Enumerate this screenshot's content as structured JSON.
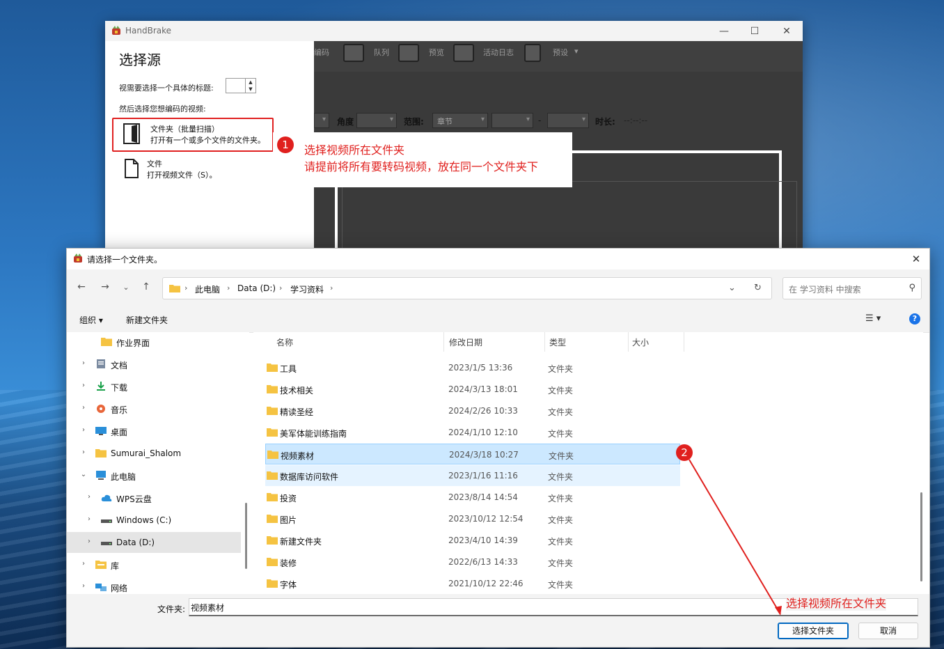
{
  "handbrake": {
    "title": "HandBrake",
    "toolbar": [
      "编码",
      "队列",
      "预览",
      "活动日志",
      "预设"
    ],
    "row2": {
      "angle_label": "角度",
      "range_label": "范围:",
      "range_value": "章节",
      "dash": "-",
      "duration_label": "时长:",
      "duration_value": "--:--:--"
    },
    "window_controls": {
      "minimize": "—",
      "maximize": "☐",
      "close": "✕"
    }
  },
  "source_panel": {
    "title": "选择源",
    "question1": "视需要选择一个具体的标题:",
    "question2": "然后选择您想编码的视频:",
    "folder_option": {
      "line1": "文件夹（批量扫描）",
      "line2": "打开有一个或多个文件的文件夹。"
    },
    "file_option": {
      "line1": "文件",
      "line2": "打开视频文件（S）。"
    }
  },
  "annotations": {
    "badge1": "1",
    "text1_line1": "选择视频所在文件夹",
    "text1_line2": "请提前将所有要转码视频，放在同一个文件夹下",
    "badge2": "2",
    "text2": "选择视频所在文件夹"
  },
  "dialog": {
    "title": "请选择一个文件夹。",
    "close": "✕",
    "breadcrumb": [
      "此电脑",
      "Data (D:)",
      "学习资料"
    ],
    "search_placeholder": "在 学习资料 中搜索",
    "commands": {
      "organize": "组织 ▾",
      "new_folder": "新建文件夹"
    },
    "help": "?",
    "nav_items": [
      {
        "label": "作业界面",
        "chevron": "",
        "indent": 1,
        "icon": "folder-icon",
        "color": "#f5c342"
      },
      {
        "label": "文档",
        "chevron": "›",
        "indent": 0,
        "icon": "document-icon",
        "color": "#7a8aa0"
      },
      {
        "label": "下载",
        "chevron": "›",
        "indent": 0,
        "icon": "download-icon",
        "color": "#1aa14a"
      },
      {
        "label": "音乐",
        "chevron": "›",
        "indent": 0,
        "icon": "music-icon",
        "color": "#e8663a"
      },
      {
        "label": "桌面",
        "chevron": "›",
        "indent": 0,
        "icon": "desktop-icon",
        "color": "#2a8fd9"
      },
      {
        "label": "Sumurai_Shalom",
        "chevron": "›",
        "indent": 0,
        "icon": "folder-icon",
        "color": "#f5c342"
      },
      {
        "label": "此电脑",
        "chevron": "⌄",
        "indent": 0,
        "icon": "computer-icon",
        "color": "#2a8fd9"
      },
      {
        "label": "WPS云盘",
        "chevron": "›",
        "indent": 1,
        "icon": "cloud-icon",
        "color": "#2a8fd9"
      },
      {
        "label": "Windows (C:)",
        "chevron": "›",
        "indent": 1,
        "icon": "drive-icon",
        "color": "#555555"
      },
      {
        "label": "Data (D:)",
        "chevron": "›",
        "indent": 1,
        "icon": "drive-icon",
        "color": "#555555",
        "selected": true
      },
      {
        "label": "库",
        "chevron": "›",
        "indent": 0,
        "icon": "library-icon",
        "color": "#f5c342"
      },
      {
        "label": "网络",
        "chevron": "›",
        "indent": 0,
        "icon": "network-icon",
        "color": "#2a8fd9"
      }
    ],
    "columns": [
      "名称",
      "修改日期",
      "类型",
      "大小"
    ],
    "files": [
      {
        "name": "工具",
        "date": "2023/1/5 13:36",
        "type": "文件夹"
      },
      {
        "name": "技术相关",
        "date": "2024/3/13 18:01",
        "type": "文件夹"
      },
      {
        "name": "精读圣经",
        "date": "2024/2/26 10:33",
        "type": "文件夹"
      },
      {
        "name": "美军体能训练指南",
        "date": "2024/1/10 12:10",
        "type": "文件夹"
      },
      {
        "name": "视频素材",
        "date": "2024/3/18 10:27",
        "type": "文件夹",
        "state": "selected"
      },
      {
        "name": "数据库访问软件",
        "date": "2023/1/16 11:16",
        "type": "文件夹",
        "state": "hover"
      },
      {
        "name": "投资",
        "date": "2023/8/14 14:54",
        "type": "文件夹"
      },
      {
        "name": "图片",
        "date": "2023/10/12 12:54",
        "type": "文件夹"
      },
      {
        "name": "新建文件夹",
        "date": "2023/4/10 14:39",
        "type": "文件夹"
      },
      {
        "name": "装修",
        "date": "2022/6/13 14:33",
        "type": "文件夹"
      },
      {
        "name": "字体",
        "date": "2021/10/12 22:46",
        "type": "文件夹"
      }
    ],
    "folder_label": "文件夹:",
    "folder_value": "视频素材",
    "select_button": "选择文件夹",
    "cancel_button": "取消"
  },
  "colors": {
    "accent_red": "#e0201e",
    "folder_yellow": "#f5c342",
    "selection_blue": "#cce8ff"
  }
}
